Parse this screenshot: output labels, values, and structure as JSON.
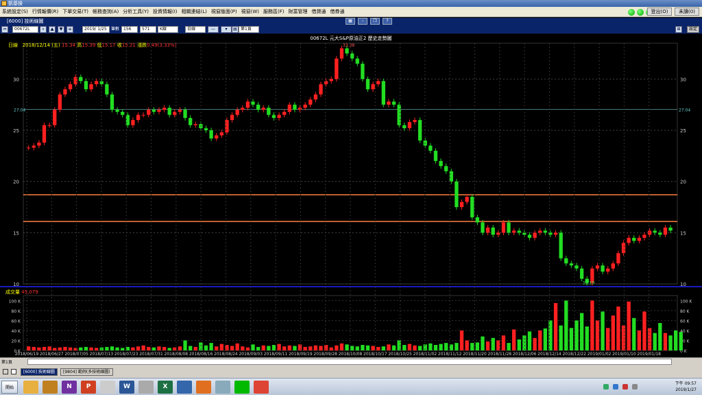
{
  "window": {
    "title": "凱基操"
  },
  "menu": [
    "系統設定(S)",
    "行情報價(R)",
    "下單交易(T)",
    "帳務查詢(A)",
    "分析工具(Y)",
    "投資情報(I)",
    "相關連結(L)",
    "視窗版面(P)",
    "視窗(W)",
    "服務區(F)",
    "財富管理",
    "借貸通",
    "借券通"
  ],
  "system_buttons": {
    "login": "登出(O)",
    "quit": "未讀(0)"
  },
  "panel": {
    "title": "[6000] 技術線圖",
    "setting": "設定"
  },
  "toolbar": {
    "symbol": "00672L",
    "date": "2019/ 1/25",
    "bars_label": "筆數",
    "bars": "156",
    "count": "571",
    "period": "K線",
    "freq": "日線",
    "page": "第1頁"
  },
  "chart": {
    "title": "00672L 元大S&P原油正2  歷史走勢圖",
    "info_prefix": "日線",
    "info_date": "2018/12/14 (五)",
    "info_open_label": "開",
    "info_open": "15.34",
    "info_high_label": "高",
    "info_high": "15.39",
    "info_low_label": "低",
    "info_low": "15.17",
    "info_close_label": "收",
    "info_close": "15.21",
    "info_change_label": "漲跌",
    "info_change": "0.49(3.33%)",
    "price_marker": "27.04",
    "high_label": "33.38",
    "low_label": "10.10",
    "volume_label": "成交量",
    "volume_value": "45,079",
    "y_ticks": [
      "30",
      "25",
      "20",
      "15",
      "10"
    ],
    "vol_ticks": [
      "100 K",
      "80 K",
      "60 K",
      "40 K",
      "20 K",
      "0 K"
    ],
    "x_labels": [
      "2018/06/19",
      "2018/06/27",
      "2018/07/05",
      "2018/07/13",
      "2018/07/23",
      "2018/07/31",
      "2018/08/08",
      "2018/08/16",
      "2018/08/24",
      "2018/09/03",
      "2018/09/11",
      "2018/09/19",
      "2018/09/28",
      "2018/10/08",
      "2018/10/17",
      "2018/10/25",
      "2018/11/02",
      "2018/11/12",
      "2018/11/20",
      "2018/11/28",
      "2018/12/06",
      "2018/12/14",
      "2018/12/22",
      "2019/01/02",
      "2019/01/10",
      "2019/01/18"
    ],
    "up_color": "#ff2020",
    "down_color": "#22dd22",
    "hline_color": "#ff8040",
    "page_label": "第1頁"
  },
  "chart_data": {
    "type": "candlestick",
    "ylim": [
      10,
      33.5
    ],
    "hlines": [
      18.7,
      16.1,
      27.04
    ],
    "closes": [
      23.3,
      23.5,
      23.8,
      25.5,
      25.5,
      27.0,
      28.5,
      29.0,
      29.5,
      30.2,
      29.8,
      29.0,
      29.5,
      29.8,
      29.5,
      28.5,
      27.0,
      26.8,
      26.5,
      25.5,
      26.0,
      26.5,
      26.5,
      27.0,
      26.8,
      27.0,
      27.2,
      26.5,
      26.8,
      27.0,
      26.2,
      25.5,
      25.6,
      25.2,
      25.0,
      24.2,
      24.5,
      24.8,
      26.0,
      26.5,
      27.0,
      27.2,
      27.8,
      27.5,
      27.0,
      27.2,
      26.5,
      26.2,
      26.5,
      26.8,
      27.5,
      27.0,
      27.2,
      27.5,
      28.0,
      28.5,
      29.5,
      29.8,
      30.0,
      32.0,
      33.0,
      32.5,
      32.0,
      31.5,
      30.0,
      29.0,
      29.5,
      29.8,
      27.5,
      27.8,
      27.5,
      25.5,
      25.2,
      25.8,
      26.0,
      24.0,
      23.5,
      23.0,
      22.0,
      21.5,
      21.0,
      20.0,
      17.5,
      18.0,
      18.5,
      16.5,
      16.0,
      15.0,
      15.5,
      14.8,
      15.0,
      16.0,
      15.0,
      15.2,
      15.0,
      14.8,
      14.5,
      15.0,
      15.2,
      15.0,
      14.8,
      15.0,
      12.5,
      12.0,
      11.8,
      11.5,
      10.5,
      10.1,
      11.5,
      11.8,
      11.2,
      11.5,
      12.0,
      13.0,
      14.0,
      14.5,
      14.2,
      14.5,
      14.8,
      15.2,
      15.0,
      14.8,
      15.5,
      15.2
    ],
    "volumes": [
      8,
      7,
      6,
      7,
      8,
      5,
      6,
      7,
      6,
      5,
      6,
      7,
      6,
      5,
      6,
      7,
      8,
      6,
      5,
      7,
      6,
      8,
      10,
      7,
      6,
      8,
      7,
      5,
      6,
      8,
      20,
      9,
      7,
      16,
      10,
      15,
      8,
      13,
      11,
      9,
      14,
      8,
      6,
      12,
      7,
      10,
      9,
      11,
      13,
      8,
      10,
      9,
      12,
      7,
      8,
      10,
      9,
      11,
      6,
      10,
      14,
      12,
      9,
      8,
      11,
      10,
      9,
      7,
      8,
      12,
      10,
      20,
      11,
      13,
      10,
      9,
      12,
      14,
      11,
      13,
      15,
      12,
      15,
      40,
      20,
      15,
      16,
      28,
      18,
      25,
      20,
      30,
      15,
      42,
      22,
      30,
      38,
      25,
      40,
      44,
      60,
      95,
      50,
      100,
      45,
      60,
      75,
      48,
      100,
      60,
      78,
      45,
      70,
      88,
      50,
      98,
      65,
      40,
      78,
      45,
      35,
      55,
      35,
      30,
      40,
      37
    ]
  }
}
